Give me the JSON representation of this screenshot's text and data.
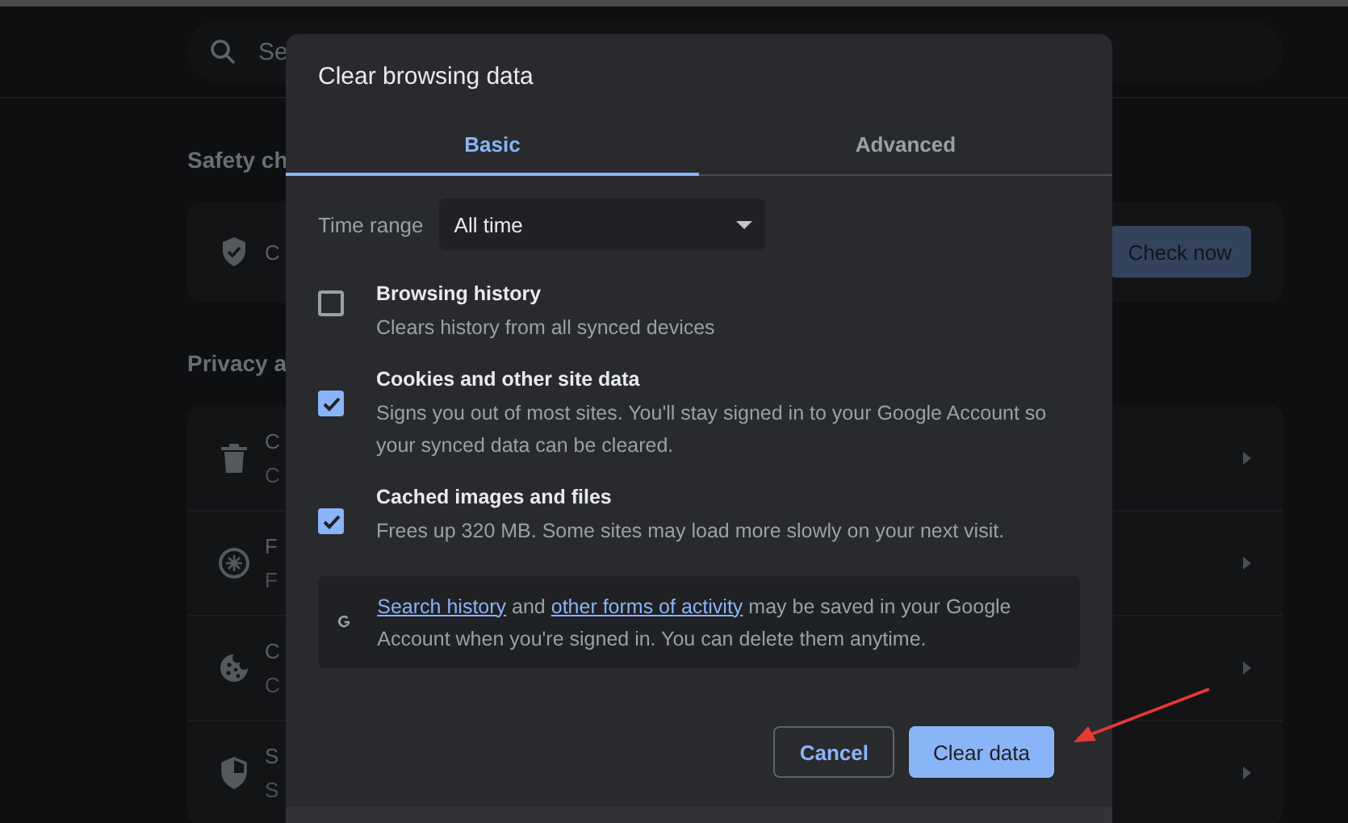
{
  "page": {
    "search": {
      "placeholder": "Se"
    },
    "sections": [
      {
        "title": "Safety ch",
        "rows": [
          {
            "title": "C",
            "button": "Check now"
          }
        ]
      },
      {
        "title": "Privacy a",
        "rows": [
          {
            "title": "C",
            "subtitle": "C"
          },
          {
            "title": "F",
            "subtitle": "F"
          },
          {
            "title": "C",
            "subtitle": "C"
          },
          {
            "title": "S",
            "subtitle": "S"
          }
        ]
      }
    ]
  },
  "dialog": {
    "title": "Clear browsing data",
    "tabs": [
      {
        "label": "Basic",
        "selected": true
      },
      {
        "label": "Advanced",
        "selected": false
      }
    ],
    "time_range": {
      "label": "Time range",
      "value": "All time"
    },
    "options": [
      {
        "title": "Browsing history",
        "description": "Clears history from all synced devices",
        "checked": false
      },
      {
        "title": "Cookies and other site data",
        "description": "Signs you out of most sites. You'll stay signed in to your Google Account so your synced data can be cleared.",
        "checked": true
      },
      {
        "title": "Cached images and files",
        "description": "Frees up 320 MB. Some sites may load more slowly on your next visit.",
        "checked": true
      }
    ],
    "notice": {
      "segments": [
        {
          "kind": "link",
          "text": "Search history"
        },
        {
          "kind": "plain",
          "text": "and"
        },
        {
          "kind": "link",
          "text": "other forms of activity"
        },
        {
          "kind": "plain",
          "text": "may be saved in your Google Account when you're signed in. You can delete them anytime."
        }
      ]
    },
    "buttons": [
      {
        "label": "Cancel",
        "kind": "secondary"
      },
      {
        "label": "Clear data",
        "kind": "primary"
      }
    ]
  }
}
